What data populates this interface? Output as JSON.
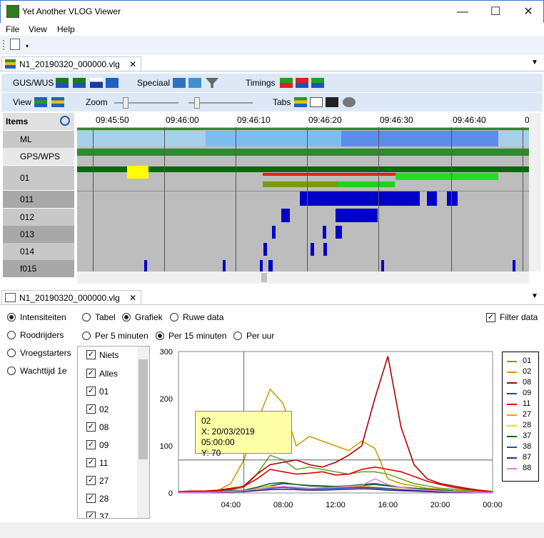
{
  "window": {
    "title": "Yet Another VLOG Viewer",
    "min": "—",
    "max": "☐",
    "close": "✕"
  },
  "menu": [
    "File",
    "View",
    "Help"
  ],
  "doc1": {
    "tab": "N1_20190320_000000.vlg"
  },
  "toolbar": {
    "gus_wus": "GUS/WUS",
    "speciaal": "Speciaal",
    "timings": "Timings",
    "view": "View",
    "zoom": "Zoom",
    "tabs": "Tabs"
  },
  "items_header": "Items",
  "items": [
    "ML",
    "GPS/WPS",
    "01",
    "011",
    "012",
    "013",
    "014",
    "f015"
  ],
  "ruler": [
    "09:45:50",
    "09:46:00",
    "09:46:10",
    "09:46:20",
    "09:46:30",
    "09:46:40",
    "0"
  ],
  "doc2": {
    "tab": "N1_20190320_000000.vlg"
  },
  "left_options": [
    "Intensiteiten",
    "Roodrijders",
    "Vroegstarters",
    "Wachttijd 1e"
  ],
  "left_selected": 0,
  "view_modes": [
    "Tabel",
    "Grafiek",
    "Ruwe data"
  ],
  "view_selected": 1,
  "filter_label": "Filter data",
  "filter_checked": true,
  "periods": [
    "Per 5 minuten",
    "Per 15 minuten",
    "Per uur"
  ],
  "period_selected": 1,
  "list": [
    "Niets",
    "Alles",
    "01",
    "02",
    "08",
    "09",
    "11",
    "27",
    "28",
    "37"
  ],
  "tooltip": {
    "series": "02",
    "x": "X: 20/03/2019 05:00:00",
    "y": "Y: 70"
  },
  "chart_data": {
    "type": "line",
    "ylim": [
      0,
      300
    ],
    "yticks": [
      "0",
      "100",
      "200",
      "300"
    ],
    "xticks": [
      "04:00",
      "08:00",
      "12:00",
      "16:00",
      "20:00",
      "00:00"
    ],
    "x_hours": [
      0,
      1,
      2,
      3,
      4,
      5,
      6,
      7,
      8,
      9,
      10,
      11,
      12,
      13,
      14,
      15,
      16,
      17,
      18,
      19,
      20,
      21,
      22,
      23,
      24
    ],
    "series": [
      {
        "name": "01",
        "color": "#6aa728",
        "values": [
          3,
          4,
          3,
          5,
          6,
          12,
          40,
          80,
          70,
          50,
          55,
          50,
          45,
          40,
          45,
          45,
          40,
          30,
          20,
          15,
          10,
          8,
          6,
          4,
          3
        ]
      },
      {
        "name": "02",
        "color": "#c8a000",
        "values": [
          2,
          2,
          2,
          5,
          20,
          70,
          150,
          220,
          190,
          100,
          120,
          110,
          100,
          90,
          110,
          95,
          30,
          20,
          15,
          10,
          8,
          5,
          4,
          3,
          2
        ]
      },
      {
        "name": "08",
        "color": "#b00000",
        "values": [
          2,
          3,
          2,
          4,
          8,
          15,
          40,
          60,
          65,
          70,
          60,
          55,
          65,
          80,
          100,
          200,
          290,
          140,
          60,
          30,
          20,
          15,
          10,
          6,
          3
        ]
      },
      {
        "name": "09",
        "color": "#1a4f8a",
        "values": [
          1,
          1,
          2,
          2,
          4,
          6,
          10,
          15,
          20,
          18,
          15,
          14,
          12,
          14,
          16,
          18,
          15,
          12,
          10,
          8,
          6,
          4,
          3,
          2,
          1
        ]
      },
      {
        "name": "11",
        "color": "#e00000",
        "values": [
          3,
          4,
          4,
          6,
          10,
          14,
          30,
          50,
          45,
          40,
          42,
          45,
          38,
          40,
          50,
          55,
          50,
          45,
          35,
          25,
          18,
          12,
          8,
          5,
          3
        ]
      },
      {
        "name": "27",
        "color": "#f0a000",
        "values": [
          1,
          1,
          1,
          2,
          3,
          5,
          8,
          10,
          12,
          10,
          9,
          10,
          11,
          12,
          14,
          12,
          10,
          8,
          6,
          4,
          3,
          2,
          2,
          1,
          1
        ]
      },
      {
        "name": "28",
        "color": "#f0e000",
        "values": [
          1,
          1,
          1,
          2,
          3,
          5,
          10,
          14,
          12,
          10,
          8,
          9,
          10,
          11,
          12,
          10,
          9,
          8,
          6,
          4,
          3,
          2,
          2,
          1,
          1
        ]
      },
      {
        "name": "37",
        "color": "#107010",
        "values": [
          1,
          1,
          1,
          2,
          3,
          6,
          12,
          20,
          22,
          18,
          16,
          15,
          14,
          15,
          18,
          20,
          16,
          12,
          10,
          8,
          5,
          3,
          2,
          1,
          1
        ]
      },
      {
        "name": "38",
        "color": "#1050c0",
        "values": [
          1,
          1,
          1,
          2,
          3,
          4,
          8,
          10,
          12,
          10,
          9,
          9,
          10,
          11,
          12,
          11,
          9,
          7,
          5,
          4,
          3,
          2,
          1,
          1,
          1
        ]
      },
      {
        "name": "87",
        "color": "#402080",
        "values": [
          1,
          1,
          1,
          1,
          2,
          3,
          5,
          7,
          8,
          7,
          6,
          6,
          7,
          8,
          9,
          8,
          6,
          5,
          4,
          3,
          2,
          2,
          1,
          1,
          1
        ]
      },
      {
        "name": "88",
        "color": "#e080e0",
        "values": [
          1,
          1,
          1,
          2,
          3,
          5,
          8,
          12,
          14,
          12,
          10,
          11,
          12,
          14,
          16,
          30,
          18,
          12,
          8,
          6,
          4,
          3,
          2,
          1,
          1
        ]
      }
    ]
  }
}
